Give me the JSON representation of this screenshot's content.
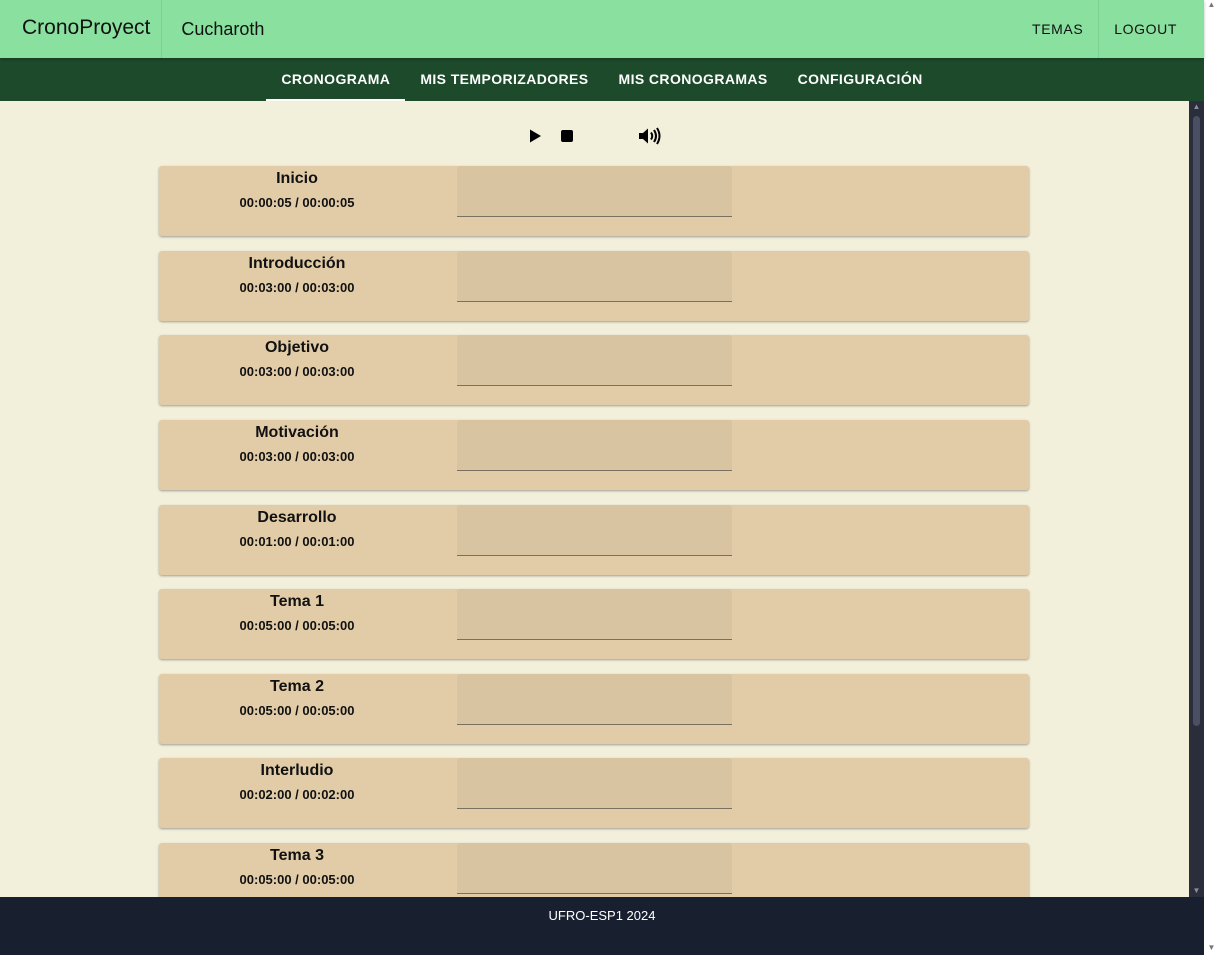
{
  "appbar": {
    "brand": "CronoProyect",
    "user": "Cucharoth",
    "temas_label": "TEMAS",
    "logout_label": "LOGOUT"
  },
  "tabs": [
    {
      "label": "CRONOGRAMA",
      "active": true
    },
    {
      "label": "MIS TEMPORIZADORES",
      "active": false
    },
    {
      "label": "MIS CRONOGRAMAS",
      "active": false
    },
    {
      "label": "CONFIGURACIÓN",
      "active": false
    }
  ],
  "controls": {
    "play_icon": "play-icon",
    "stop_icon": "stop-icon",
    "volume_icon": "volume-icon"
  },
  "timers": [
    {
      "name": "Inicio",
      "time": "00:00:05 / 00:00:05",
      "value": ""
    },
    {
      "name": "Introducción",
      "time": "00:03:00 / 00:03:00",
      "value": ""
    },
    {
      "name": "Objetivo",
      "time": "00:03:00 / 00:03:00",
      "value": ""
    },
    {
      "name": "Motivación",
      "time": "00:03:00 / 00:03:00",
      "value": ""
    },
    {
      "name": "Desarrollo",
      "time": "00:01:00 / 00:01:00",
      "value": ""
    },
    {
      "name": "Tema 1",
      "time": "00:05:00 / 00:05:00",
      "value": ""
    },
    {
      "name": "Tema 2",
      "time": "00:05:00 / 00:05:00",
      "value": ""
    },
    {
      "name": "Interludio",
      "time": "00:02:00 / 00:02:00",
      "value": ""
    },
    {
      "name": "Tema 3",
      "time": "00:05:00 / 00:05:00",
      "value": ""
    }
  ],
  "footer": {
    "text": "UFRO-ESP1 2024",
    "icon": "github-icon"
  },
  "colors": {
    "appbar": "#89e09f",
    "tabbar": "#1c4a2a",
    "background": "#f2efdb",
    "card": "#e2cca8",
    "footer": "#182030"
  }
}
